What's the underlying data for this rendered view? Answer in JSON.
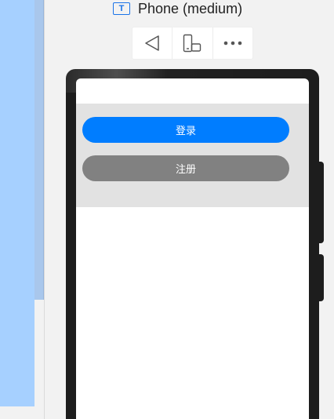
{
  "window": {
    "device_title": "Phone (medium)",
    "title_icon_glyph": "T"
  },
  "toolbar": {
    "items": [
      {
        "name": "back-triangle-icon"
      },
      {
        "name": "rotate-device-icon"
      },
      {
        "name": "more-options-icon"
      }
    ]
  },
  "app": {
    "login_label": "登录",
    "register_label": "注册",
    "colors": {
      "login_bg": "#007dff",
      "register_bg": "#818181",
      "content_bg": "#e2e2e2"
    }
  }
}
